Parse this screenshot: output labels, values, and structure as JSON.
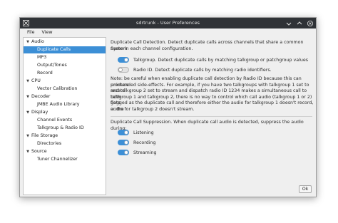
{
  "window": {
    "title": "sdrtrunk - User Preferences"
  },
  "menu": [
    "File",
    "View"
  ],
  "sidebar": {
    "items": [
      {
        "label": "Audio",
        "level": 0,
        "expanded": true
      },
      {
        "label": "Duplicate Calls",
        "level": 1,
        "selected": true
      },
      {
        "label": "MP3",
        "level": 1
      },
      {
        "label": "Output/Tones",
        "level": 1
      },
      {
        "label": "Record",
        "level": 1
      },
      {
        "label": "CPU",
        "level": 0,
        "expanded": true
      },
      {
        "label": "Vector Calibration",
        "level": 1
      },
      {
        "label": "Decoder",
        "level": 0,
        "expanded": true
      },
      {
        "label": "JMBE Audio Library",
        "level": 1
      },
      {
        "label": "Display",
        "level": 0,
        "expanded": true
      },
      {
        "label": "Channel Events",
        "level": 1
      },
      {
        "label": "Talkgroup & Radio ID",
        "level": 1
      },
      {
        "label": "File Storage",
        "level": 0,
        "expanded": true
      },
      {
        "label": "Directories",
        "level": 1
      },
      {
        "label": "Source",
        "level": 0,
        "expanded": true
      },
      {
        "label": "Tuner Channelizer",
        "level": 1
      }
    ]
  },
  "content": {
    "detection_intro_line1": "Duplicate Call Detection.  Detect duplicate calls across channels that share a common System",
    "detection_intro_line2": "name in each channel configuration.",
    "options_detection": [
      {
        "label": "Talkgroup.  Detect duplicate calls by matching talkgroup or patchgroup values",
        "on": true
      },
      {
        "label": "Radio ID.  Detect duplicate calls by matching radio identifiers.",
        "on": false
      }
    ],
    "note_lines": [
      "Note: be careful when enabling duplicate call detection by Radio ID because this can produce",
      "unintended side-effects.  For example, if you have two talkgroups with talkgroup 1 set to record",
      "and talkgroup 2 set to stream and dispatch radio ID 1234 makes a simultaneous call to both",
      "talkgroup 1 and talkgroup 2, there is no way to control which call audio (talkgroup 1 or 2) gets",
      "flagged as the duplicate call and therefore either the audio for talkgroup 1 doesn't record, or the",
      "audio for talkgroup 2 doesn't stream."
    ],
    "suppression_intro": "Duplicate Call Suppression.  When duplicate call audio is detected, suppress the audio during:",
    "options_suppression": [
      {
        "label": "Listening",
        "on": true
      },
      {
        "label": "Recording",
        "on": true
      },
      {
        "label": "Streaming",
        "on": true
      }
    ]
  },
  "buttons": {
    "ok": "Ok"
  },
  "colors": {
    "accent": "#3c8fd6",
    "titlebar": "#2f3236"
  }
}
